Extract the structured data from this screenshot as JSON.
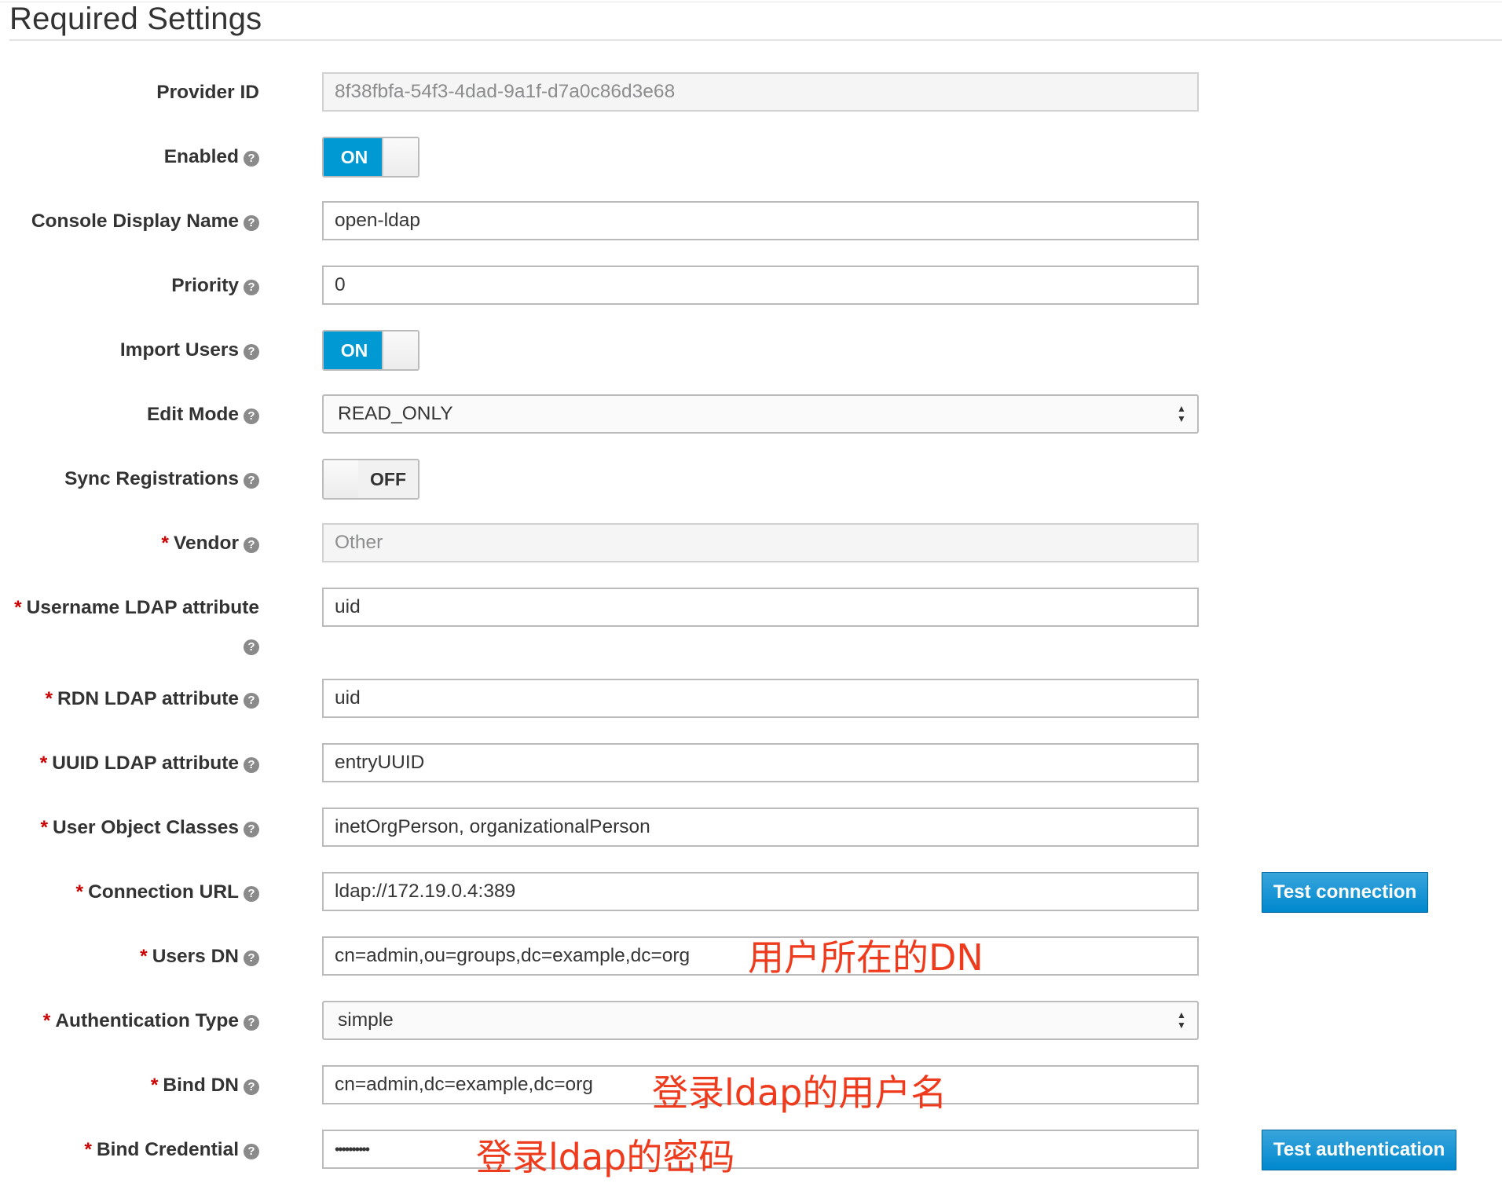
{
  "section": {
    "title": "Required Settings"
  },
  "fields": {
    "provider_id": {
      "label": "Provider ID",
      "value": "8f38fbfa-54f3-4dad-9a1f-d7a0c86d3e68"
    },
    "enabled": {
      "label": "Enabled",
      "state": "ON"
    },
    "console_display_name": {
      "label": "Console Display Name",
      "value": "open-ldap"
    },
    "priority": {
      "label": "Priority",
      "value": "0"
    },
    "import_users": {
      "label": "Import Users",
      "state": "ON"
    },
    "edit_mode": {
      "label": "Edit Mode",
      "value": "READ_ONLY"
    },
    "sync_registrations": {
      "label": "Sync Registrations",
      "state": "OFF"
    },
    "vendor": {
      "label": "Vendor",
      "value": "Other"
    },
    "username_ldap_attribute": {
      "label": "Username LDAP attribute",
      "value": "uid"
    },
    "rdn_ldap_attribute": {
      "label": "RDN LDAP attribute",
      "value": "uid"
    },
    "uuid_ldap_attribute": {
      "label": "UUID LDAP attribute",
      "value": "entryUUID"
    },
    "user_object_classes": {
      "label": "User Object Classes",
      "value": "inetOrgPerson, organizationalPerson"
    },
    "connection_url": {
      "label": "Connection URL",
      "value": "ldap://172.19.0.4:389"
    },
    "users_dn": {
      "label": "Users DN",
      "value": "cn=admin,ou=groups,dc=example,dc=org"
    },
    "authentication_type": {
      "label": "Authentication Type",
      "value": "simple"
    },
    "bind_dn": {
      "label": "Bind DN",
      "value": "cn=admin,dc=example,dc=org"
    },
    "bind_credential": {
      "label": "Bind Credential",
      "value": "••••••••••"
    }
  },
  "buttons": {
    "test_connection": "Test connection",
    "test_authentication": "Test authentication"
  },
  "annotations": {
    "users_dn_note": "用户所在的DN",
    "bind_dn_note": "登录ldap的用户名",
    "bind_credential_note": "登录ldap的密码"
  },
  "icons": {
    "help": "question-circle-icon",
    "required": "asterisk"
  },
  "colors": {
    "toggle_on": "#0099d3",
    "button_primary": "#0088ce",
    "required": "#cc0000",
    "annotation": "#ee3b1d"
  },
  "markers": {
    "required": "*",
    "help": "?"
  }
}
